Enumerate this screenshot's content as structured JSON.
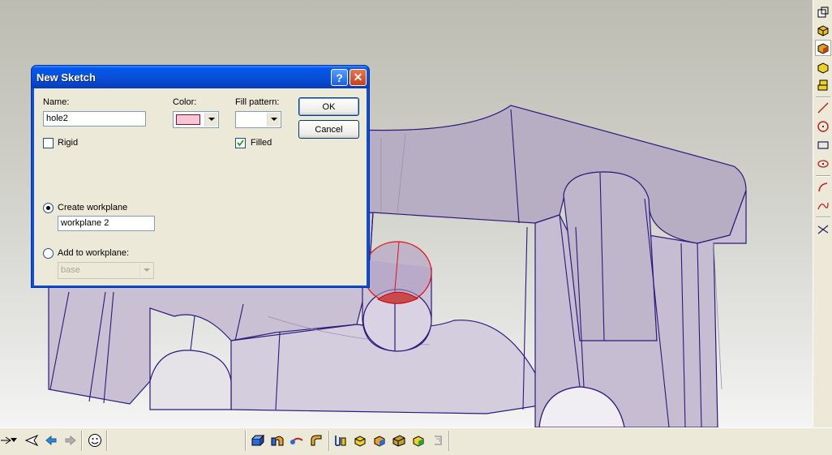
{
  "dialog": {
    "title": "New Sketch",
    "help_icon": "help-icon",
    "close_icon": "close-icon",
    "name_label": "Name:",
    "name_value": "hole2",
    "color_label": "Color:",
    "color_value": "#f6c6d6",
    "fill_pattern_label": "Fill pattern:",
    "rigid_label": "Rigid",
    "rigid_checked": false,
    "filled_label": "Filled",
    "filled_checked": true,
    "create_workplane_label": "Create workplane",
    "create_workplane_selected": true,
    "workplane_name_value": "workplane 2",
    "add_to_workplane_label": "Add to workplane:",
    "add_to_workplane_selected": false,
    "workplane_select_value": "base",
    "ok_label": "OK",
    "cancel_label": "Cancel"
  },
  "colors": {
    "model_edge": "#2b1a7a",
    "sketch_circle": "#e01010",
    "dialog_title": "#0a50d8"
  },
  "right_toolbar": [
    "workplane-icon",
    "box-view-icon",
    "box-front-icon",
    "box-solid-icon",
    "box-stack-icon",
    "line-icon",
    "circle-icon",
    "rectangle-icon",
    "ellipse-icon",
    "arc-icon",
    "spline-icon",
    "trim-icon"
  ],
  "bottom_toolbar": [
    "pointer-icon",
    "dropdown-arrow-icon",
    "back-icon",
    "previous-icon",
    "next-icon",
    "smiley-icon",
    "extrude-icon",
    "revolve-icon",
    "sweep-icon",
    "fillet-icon",
    "loft-icon",
    "shell-icon",
    "chamfer-icon",
    "draft-icon",
    "pattern-icon",
    "mirror-icon"
  ]
}
